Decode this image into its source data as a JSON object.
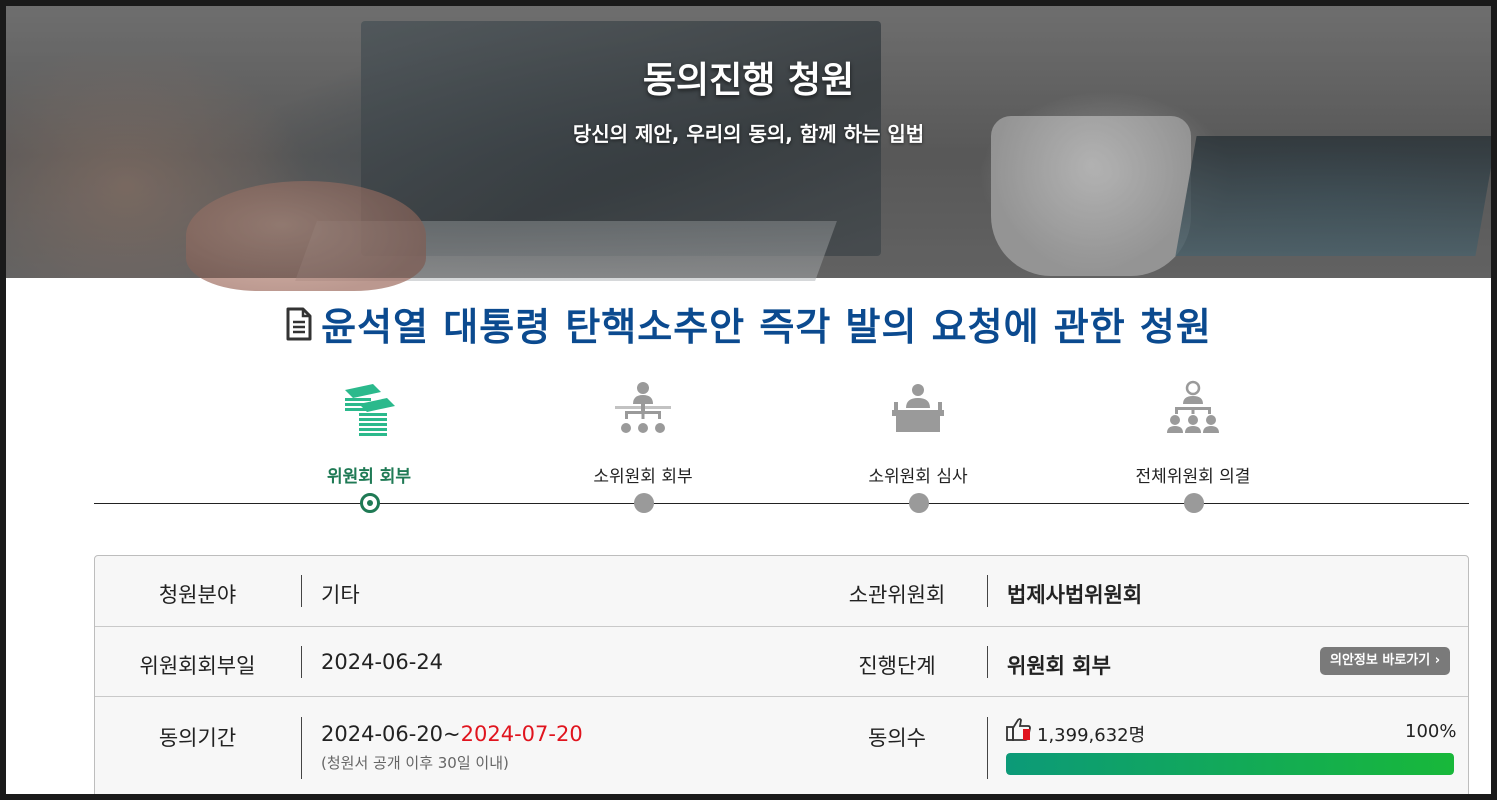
{
  "hero": {
    "title": "동의진행 청원",
    "subtitle": "당신의 제안, 우리의 동의, 함께 하는 입법"
  },
  "petition": {
    "title": "윤석열 대통령 탄핵소추안 즉각 발의 요청에 관한 청원",
    "icon": "document-icon"
  },
  "stepper": {
    "steps": [
      {
        "label": "위원회 회부",
        "icon": "papers-stack-icon",
        "active": true
      },
      {
        "label": "소위원회 회부",
        "icon": "org-chart-icon",
        "active": false
      },
      {
        "label": "소위원회 심사",
        "icon": "podium-icon",
        "active": false
      },
      {
        "label": "전체위원회 의결",
        "icon": "meeting-icon",
        "active": false
      }
    ]
  },
  "info": {
    "row1": {
      "label1": "청원분야",
      "value1": "기타",
      "label2": "소관위원회",
      "value2": "법제사법위원회"
    },
    "row2": {
      "label1": "위원회회부일",
      "value1": "2024-06-24",
      "label2": "진행단계",
      "value2": "위원회 회부",
      "button": "의안정보 바로가기 ›"
    },
    "row3": {
      "label1": "동의기간",
      "period_start": "2024-06-20~",
      "period_end": "2024-07-20",
      "period_note": "(청원서 공개 이후 30일 이내)",
      "label2": "동의수",
      "count": "1,399,632명",
      "percent_label": "100%",
      "progress": 1.0,
      "count_icon": "thumbs-up-icon"
    }
  },
  "colors": {
    "title_blue": "#0b4a8f",
    "active_green": "#1f7a55",
    "deadline_red": "#e0141e",
    "progress_start": "#0c9a78",
    "progress_end": "#18b83a"
  }
}
